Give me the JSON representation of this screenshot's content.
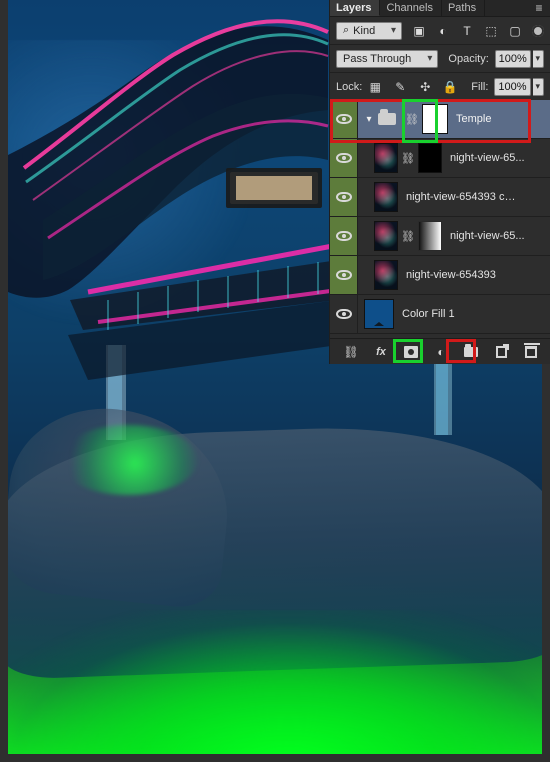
{
  "ui": {
    "tabs": {
      "layers": "Layers",
      "channels": "Channels",
      "paths": "Paths"
    },
    "icons": {
      "panel_menu": "≡",
      "search": "⌕",
      "pixel_filter": "▣",
      "adjustment_filter": "◐",
      "type_filter": "T",
      "shape_filter": "⬚",
      "smart_filter": "▢",
      "caret_down": "▾",
      "lock_transparency": "▦",
      "lock_image": "✎",
      "lock_position": "✣",
      "lock_all": "🔒",
      "chain_link": "⛓",
      "folder_open": "▾",
      "link_layers": "⛓",
      "fx": "fx",
      "adjustment": "◐"
    },
    "filter": {
      "kind_label": "Kind"
    },
    "blend": {
      "mode": "Pass Through",
      "opacity_label": "Opacity:",
      "opacity_value": "100%"
    },
    "lock": {
      "label": "Lock:",
      "fill_label": "Fill:",
      "fill_value": "100%"
    },
    "layers": [
      {
        "name": "Temple"
      },
      {
        "name": "night-view-65..."
      },
      {
        "name": "night-view-654393 co..."
      },
      {
        "name": "night-view-65..."
      },
      {
        "name": "night-view-654393"
      },
      {
        "name": "Color Fill 1"
      }
    ],
    "highlights": {
      "red": "#d11a1a",
      "green": "#19d12e"
    }
  }
}
